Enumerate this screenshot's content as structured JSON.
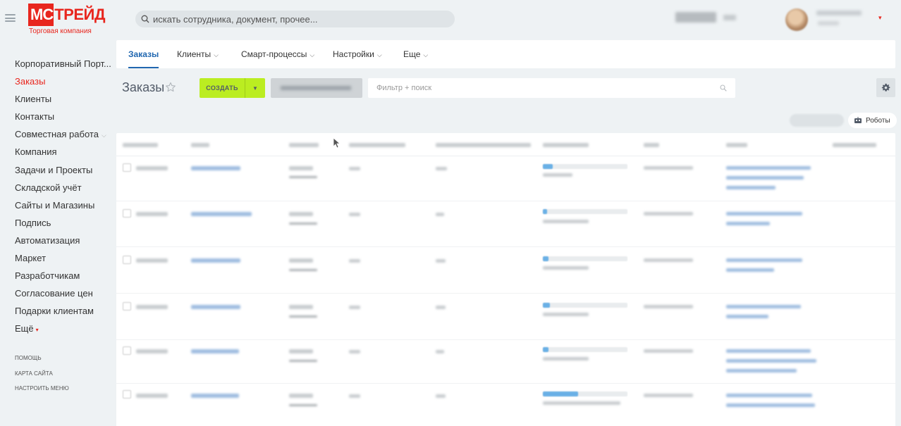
{
  "header": {
    "logo": {
      "mark": "МС",
      "rest": "ТРЕЙД",
      "subtitle": "Торговая компания"
    },
    "search": {
      "placeholder": "искать сотрудника, документ, прочее..."
    }
  },
  "sidebar": {
    "items": [
      {
        "label": "Корпоративный Порт..."
      },
      {
        "label": "Заказы",
        "active": true
      },
      {
        "label": "Клиенты"
      },
      {
        "label": "Контакты"
      },
      {
        "label": "Совместная работа",
        "has_chevron": true
      },
      {
        "label": "Компания"
      },
      {
        "label": "Задачи и Проекты"
      },
      {
        "label": "Складской учёт"
      },
      {
        "label": "Сайты и Магазины"
      },
      {
        "label": "Подпись"
      },
      {
        "label": "Автоматизация"
      },
      {
        "label": "Маркет"
      },
      {
        "label": "Разработчикам"
      },
      {
        "label": "Согласование цен"
      },
      {
        "label": "Подарки клиентам"
      },
      {
        "label": "Ещё",
        "has_more_arrow": true
      }
    ],
    "footer_links": [
      {
        "label": "ПОМОЩЬ"
      },
      {
        "label": "КАРТА САЙТА"
      },
      {
        "label": "НАСТРОИТЬ МЕНЮ"
      }
    ]
  },
  "tabs": [
    {
      "label": "Заказы",
      "active": true
    },
    {
      "label": "Клиенты",
      "has_chevron": true
    },
    {
      "label": "Смарт-процессы",
      "has_chevron": true
    },
    {
      "label": "Настройки",
      "has_chevron": true
    },
    {
      "label": "Еще",
      "has_chevron": true
    }
  ],
  "toolbar": {
    "title": "Заказы",
    "create_label": "СОЗДАТЬ",
    "filter_placeholder": "Фильтр + поиск",
    "robots_label": "Роботы"
  },
  "colors": {
    "accent_red": "#e8261e",
    "tab_blue": "#2067b0",
    "create_green": "#bbed21"
  }
}
